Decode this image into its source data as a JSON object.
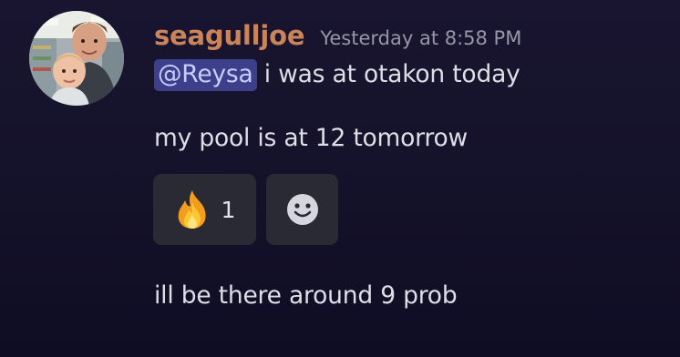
{
  "message": {
    "author": "seagulljoe",
    "timestamp": "Yesterday at 8:58 PM",
    "mention": "@Reysa",
    "line1_rest": " i was at otakon today",
    "line2": "my pool is at 12 tomorrow",
    "line3": "ill be there around 9 prob"
  },
  "reactions": [
    {
      "emoji": "fire-icon",
      "count": "1"
    }
  ],
  "colors": {
    "username": "#c98559",
    "mention_bg": "#3c3f8a",
    "reaction_bg": "#2a2a35"
  }
}
